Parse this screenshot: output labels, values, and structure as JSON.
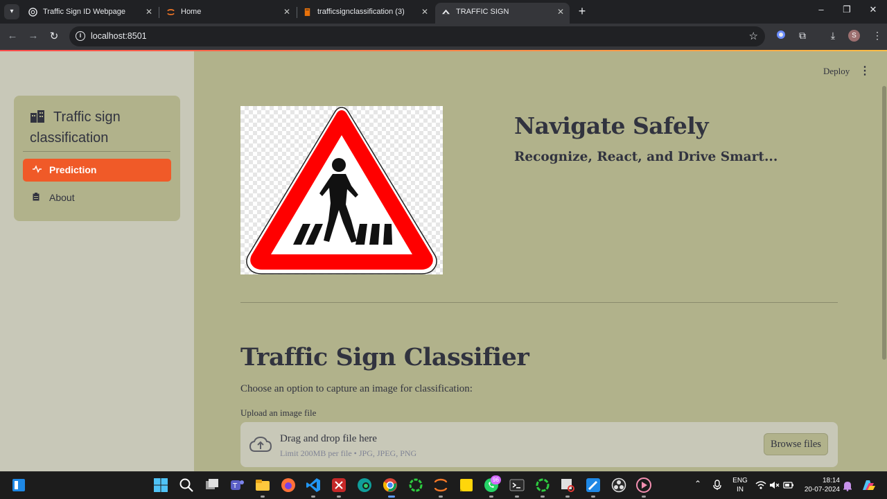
{
  "browser": {
    "tabs": [
      {
        "title": "Traffic Sign ID Webpage"
      },
      {
        "title": "Home"
      },
      {
        "title": "trafficsignclassification (3)"
      },
      {
        "title": "TRAFFIC SIGN IDENTIFICATION"
      }
    ],
    "url": "localhost:8501",
    "profile_initial": "S"
  },
  "header": {
    "deploy_label": "Deploy"
  },
  "sidebar": {
    "title": "Traffic sign classification",
    "items": [
      {
        "label": "Prediction",
        "icon": "activity-icon",
        "active": true
      },
      {
        "label": "About",
        "icon": "clipboard-icon",
        "active": false
      }
    ]
  },
  "hero": {
    "image_icon": "pedestrian-crossing-warning-sign",
    "title": "Navigate Safely",
    "subtitle": "Recognize, React, and Drive Smart..."
  },
  "classifier": {
    "title": "Traffic Sign Classifier",
    "description": "Choose an option to capture an image for classification:",
    "upload_label": "Upload an image file",
    "drop_text": "Drag and drop file here",
    "limit_text": "Limit 200MB per file • JPG, JPEG, PNG",
    "browse_label": "Browse files"
  },
  "taskbar": {
    "whatsapp_badge": "96",
    "language": "ENG",
    "region": "IN",
    "time": "18:14",
    "date": "20-07-2024"
  },
  "colors": {
    "main_bg": "#b1b28b",
    "sidebar_bg": "#c8c8b8",
    "accent": "#f05a28",
    "text": "#31333f"
  }
}
